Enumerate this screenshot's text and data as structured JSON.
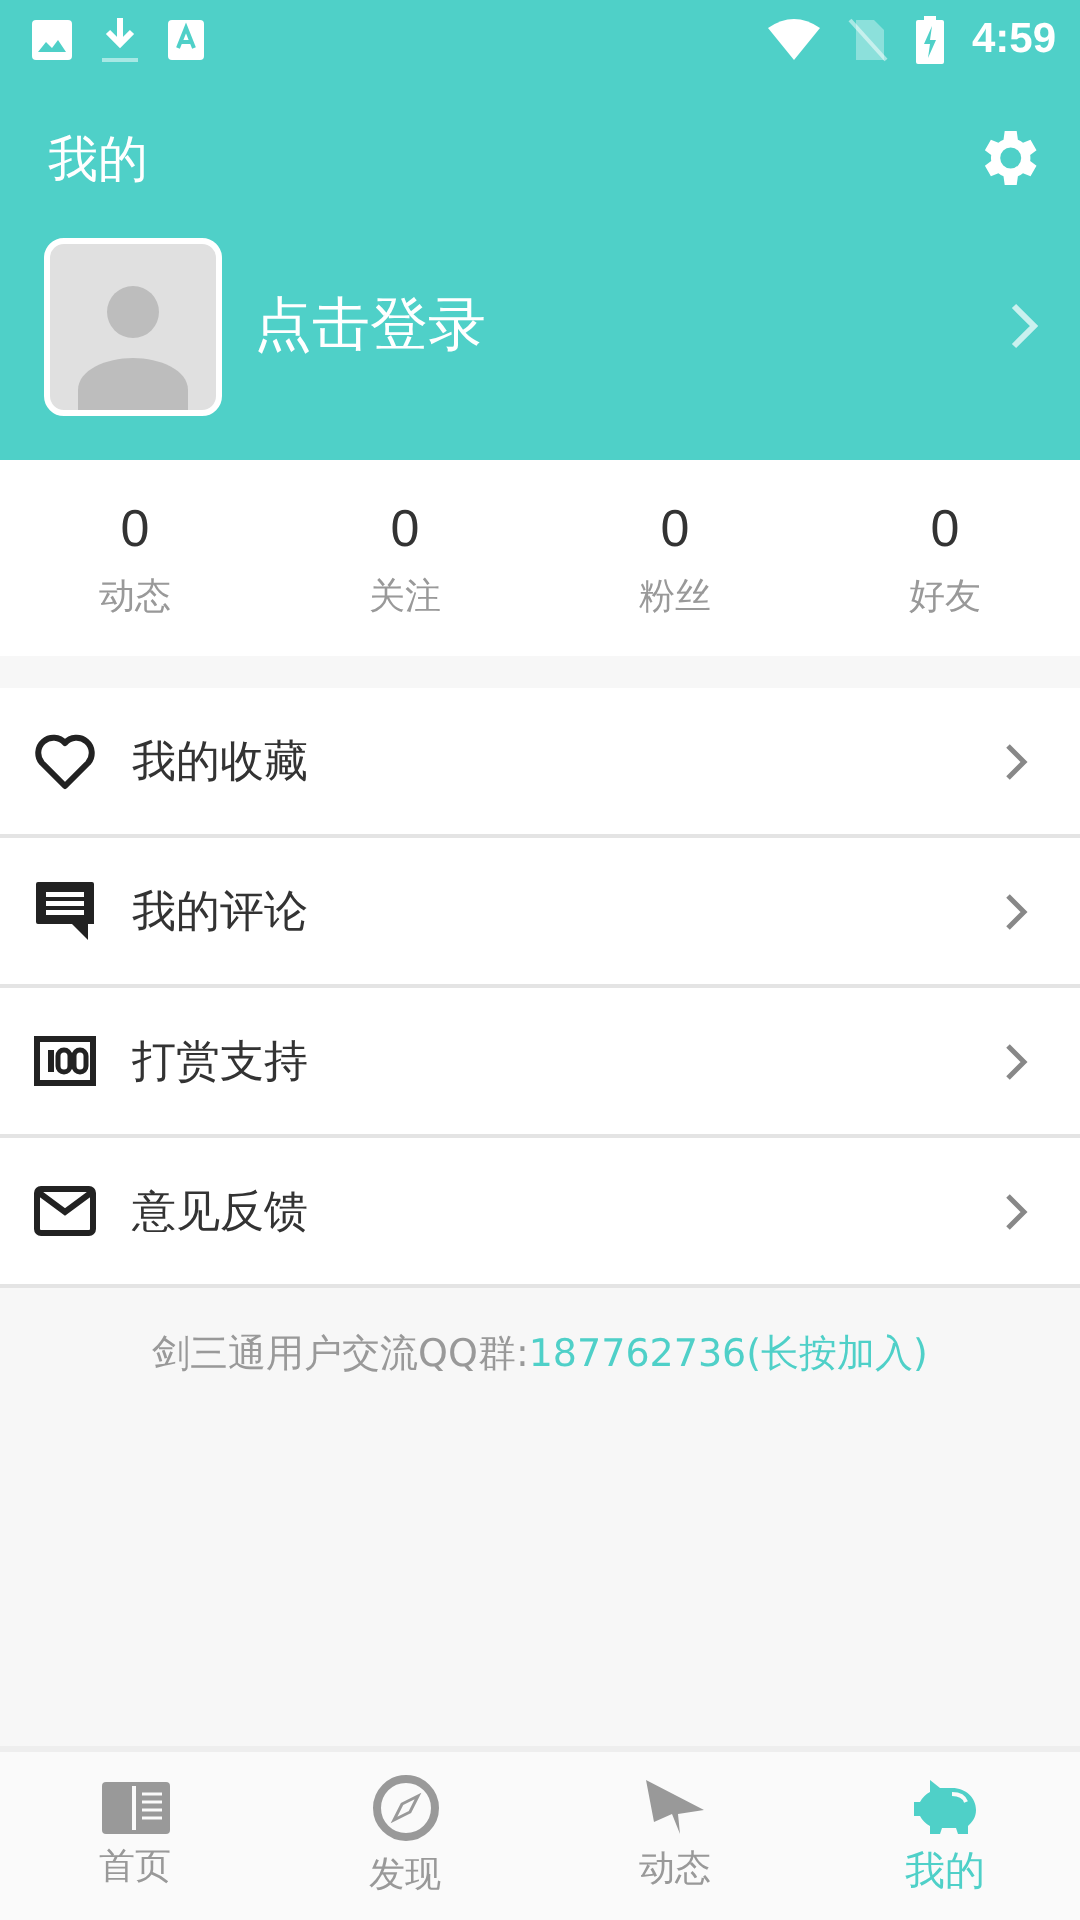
{
  "status_bar": {
    "time": "4:59"
  },
  "header": {
    "title": "我的",
    "login_text": "点击登录"
  },
  "stats": [
    {
      "value": "0",
      "label": "动态"
    },
    {
      "value": "0",
      "label": "关注"
    },
    {
      "value": "0",
      "label": "粉丝"
    },
    {
      "value": "0",
      "label": "好友"
    }
  ],
  "menu": [
    {
      "label": "我的收藏"
    },
    {
      "label": "我的评论"
    },
    {
      "label": "打赏支持"
    },
    {
      "label": "意见反馈"
    }
  ],
  "group_note": {
    "text": "剑三通用户交流QQ群:",
    "link": "187762736(长按加入)"
  },
  "tabs": [
    {
      "label": "首页",
      "selected": false
    },
    {
      "label": "发现",
      "selected": false
    },
    {
      "label": "动态",
      "selected": false
    },
    {
      "label": "我的",
      "selected": true
    }
  ]
}
